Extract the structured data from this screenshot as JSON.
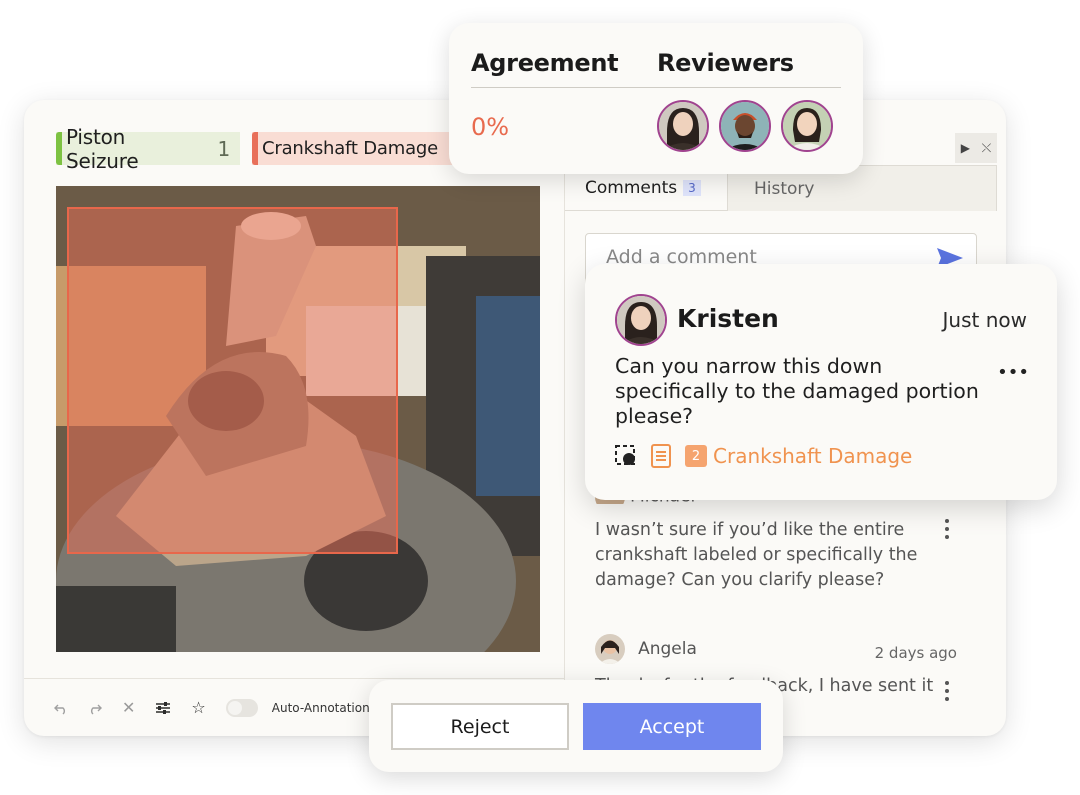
{
  "labels": [
    {
      "name": "Piston Seizure",
      "count": "1",
      "color": "#7dc242"
    },
    {
      "name": "Crankshaft Damage",
      "color": "#e8705a"
    }
  ],
  "toolbar": {
    "auto_annotation_label": "Auto-Annotation"
  },
  "panel": {
    "tabs": [
      {
        "label": "Comments",
        "count": "3"
      },
      {
        "label": "History"
      }
    ],
    "add_comment_placeholder": "Add a comment",
    "comments": [
      {
        "author": "Michael",
        "text": "I wasn’t sure if you’d like the entire crankshaft labeled or specifically the damage? Can you clarify please?"
      },
      {
        "author": "Angela",
        "time": "2 days ago",
        "text": "Thanks for the feedback, I have sent it for a second check!"
      }
    ]
  },
  "agreement": {
    "agreement_heading": "Agreement",
    "reviewers_heading": "Reviewers",
    "value": "0%",
    "value_color": "#e86a4e"
  },
  "popup_comment": {
    "author": "Kristen",
    "time": "Just now",
    "text": "Can you narrow this down specifically to the damaged portion please?",
    "label_number": "2",
    "label_name": "Crankshaft Damage",
    "label_color": "#f0934f"
  },
  "actions": {
    "reject": "Reject",
    "accept": "Accept",
    "accept_color": "#6f86ee"
  }
}
